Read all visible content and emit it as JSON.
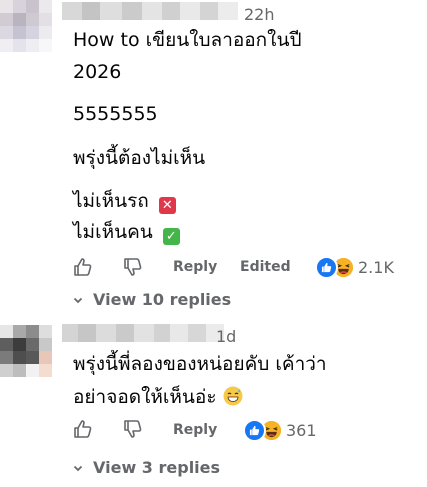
{
  "comments": [
    {
      "timestamp": "22h",
      "lines": [
        "How to เขียนใบลาออกในปี",
        "2026",
        "5555555",
        "พรุ่งนี้ต้องไม่เห็น",
        "ไม่เห็นรถ",
        "ไม่เห็นคน"
      ],
      "actions": {
        "reply": "Reply",
        "edited": "Edited"
      },
      "reaction_count": "2.1K",
      "view_replies": "View 10 replies"
    },
    {
      "timestamp": "1d",
      "lines": [
        "พรุ่งนี้พี่ลองของหน่อยคับ เค้าว่า",
        "อย่าจอดให้เห็นอ่ะ"
      ],
      "actions": {
        "reply": "Reply"
      },
      "reaction_count": "361",
      "view_replies": "View 3 replies"
    }
  ],
  "icons": [
    "like-icon",
    "dislike-icon",
    "cross-mark-emoji-icon",
    "check-mark-emoji-icon",
    "grinning-sweat-emoji-icon",
    "like-reaction-icon",
    "haha-reaction-icon",
    "chevron-down-icon"
  ],
  "colors": {
    "secondary_text": "#65676b",
    "like_blue": "#1877f2",
    "haha_yellow": "#f7b125",
    "cross_red": "#e0384b",
    "check_green": "#44b649"
  }
}
